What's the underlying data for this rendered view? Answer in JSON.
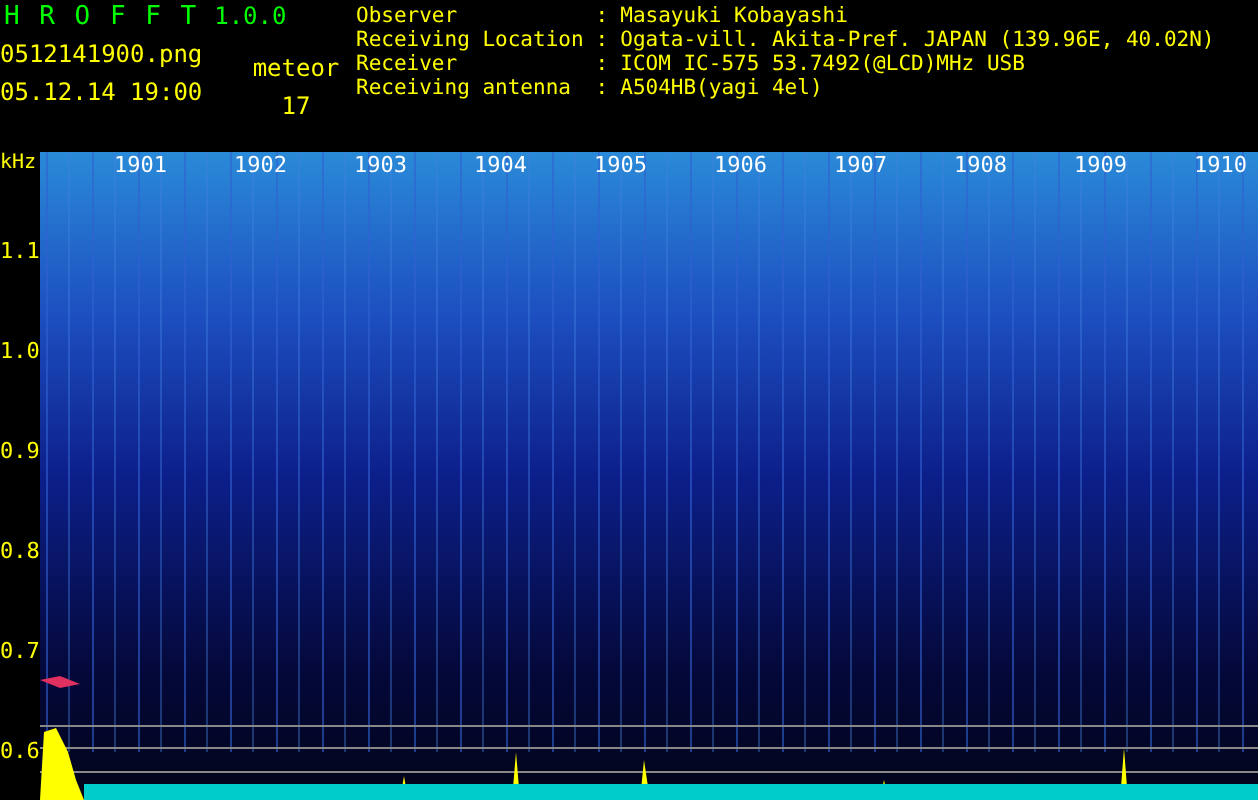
{
  "app": {
    "title": "H R O F F T",
    "version": "1.0.0",
    "file": "0512141900.png",
    "datetime": "05.12.14 19:00"
  },
  "meteor": {
    "label": "meteor",
    "count": "17"
  },
  "info": [
    {
      "label": "Observer",
      "separator": ":",
      "value": "Masayuki Kobayashi"
    },
    {
      "label": "Receiving Location",
      "separator": ":",
      "value": "Ogata-vill. Akita-Pref. JAPAN (139.96E, 40.02N)"
    },
    {
      "label": "Receiver",
      "separator": ":",
      "value": "ICOM IC-575 53.7492(@LCD)MHz USB"
    },
    {
      "label": "Receiving antenna",
      "separator": ":",
      "value": "A504HB(yagi 4el)"
    }
  ],
  "spectrogram": {
    "unit": "kHz",
    "y_labels": [
      "1.1",
      "1.0",
      "0.9",
      "0.8",
      "0.7",
      "0.6"
    ],
    "time_labels": [
      "1901",
      "1902",
      "1903",
      "1904",
      "1905",
      "1906",
      "1907",
      "1908",
      "1909",
      "1910"
    ]
  }
}
